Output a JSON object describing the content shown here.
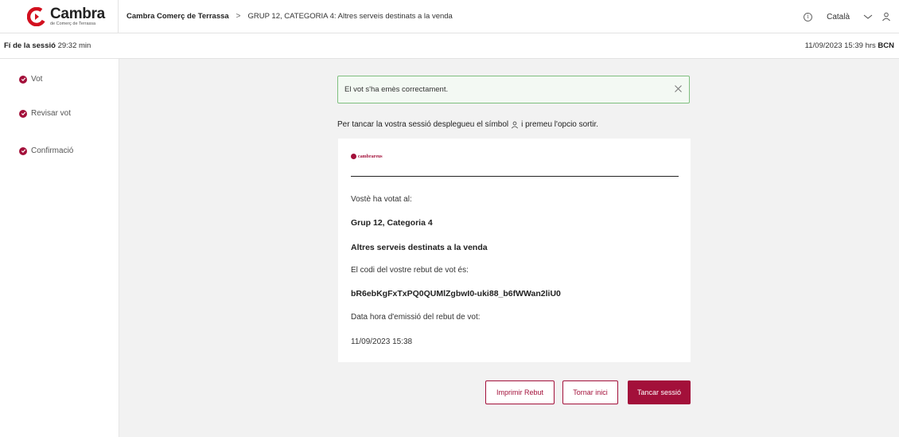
{
  "header": {
    "logo_name": "Cambra",
    "logo_sub": "de Comerç de Terrassa",
    "breadcrumb": {
      "home": "Cambra Comerç de Terrassa",
      "separator": ">",
      "current": "GRUP 12, CATEGORIA 4: Altres serveis destinats a la venda"
    },
    "language": "Català",
    "icons": [
      "info-icon",
      "chevron-down-icon",
      "user-icon"
    ]
  },
  "session": {
    "end_label": "Fí de la sessió",
    "end_value": "29:32 min",
    "datetime": "11/09/2023 15:39 hrs",
    "city": "BCN"
  },
  "sidebar": {
    "steps": [
      {
        "label": "Vot",
        "icon": "check-circle-icon"
      },
      {
        "label": "Revisar vot",
        "icon": "check-circle-icon"
      },
      {
        "label": "Confirmació",
        "icon": "check-circle-icon"
      }
    ]
  },
  "alert": {
    "message": "El vot s'ha emès correctament."
  },
  "instruction": {
    "before": "Per tancar la vostra sessió desplegueu el símbol",
    "after": "i premeu l'opcio sortir."
  },
  "receipt": {
    "logo_text": "cambrareus",
    "voted_label": "Vostè ha votat al:",
    "group": "Grup 12, Categoria 4",
    "category": "Altres serveis destinats a la venda",
    "code_label": "El codi del vostre rebut de vot és:",
    "code": "bR6ebKgFxTxPQ0QUMlZgbwI0-uki88_b6fWWan2liU0",
    "date_label": "Data hora d'emissió del rebut de vot:",
    "date": "11/09/2023 15:38"
  },
  "buttons": {
    "print": "Imprimir Rebut",
    "home": "Tornar inici",
    "logout": "Tancar sessió"
  },
  "colors": {
    "accent": "#a3103a",
    "alert_border": "#7fbf7f",
    "alert_bg": "#f3f9f3",
    "main_bg": "#f2f2f2"
  }
}
